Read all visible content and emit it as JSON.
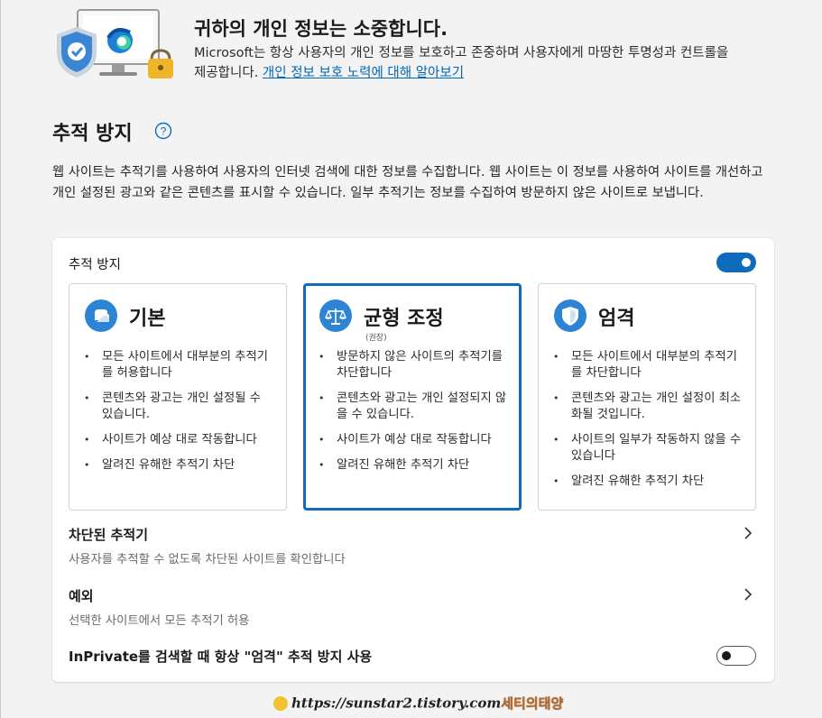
{
  "hero": {
    "title": "귀하의 개인 정보는 소중합니다.",
    "description": "Microsoft는 항상 사용자의 개인 정보를 보호하고 존중하며 사용자에게 마땅한 투명성과 컨트롤을 제공합니다. ",
    "link": "개인 정보 보호 노력에 대해 알아보기"
  },
  "section": {
    "title": "추적 방지",
    "description": "웹 사이트는 추적기를 사용하여 사용자의 인터넷 검색에 대한 정보를 수집합니다. 웹 사이트는 이 정보를 사용하여 사이트를 개선하고 개인 설정된 광고와 같은 콘텐츠를 표시할 수 있습니다. 일부 추적기는 정보를 수집하여 방문하지 않은 사이트로 보냅니다."
  },
  "card": {
    "toggle_label": "추적 방지",
    "toggle_on": true,
    "options": [
      {
        "title": "기본",
        "subtitle": "",
        "icon": "basic-shield-icon",
        "selected": false,
        "bullets": [
          "모든 사이트에서 대부분의 추적기를 허용합니다",
          "콘텐츠와 광고는 개인 설정될 수 있습니다.",
          "사이트가 예상 대로 작동합니다",
          "알려진 유해한 추적기 차단"
        ]
      },
      {
        "title": "균형 조정",
        "subtitle": "(권장)",
        "icon": "balance-scale-icon",
        "selected": true,
        "bullets": [
          "방문하지 않은 사이트의 추적기를 차단합니다",
          "콘텐츠와 광고는 개인 설정되지 않을 수 있습니다.",
          "사이트가 예상 대로 작동합니다",
          "알려진 유해한 추적기 차단"
        ]
      },
      {
        "title": "엄격",
        "subtitle": "",
        "icon": "strict-shield-icon",
        "selected": false,
        "bullets": [
          "모든 사이트에서 대부분의 추적기를 차단합니다",
          "콘텐츠와 광고는 개인 설정이 최소화될 것입니다.",
          "사이트의 일부가 작동하지 않을 수 있습니다",
          "알려진 유해한 추적기 차단"
        ]
      }
    ],
    "blocked": {
      "title": "차단된 추적기",
      "subtitle": "사용자를 추적할 수 없도록 차단된 사이트를 확인합니다"
    },
    "exceptions": {
      "title": "예외",
      "subtitle": "선택한 사이트에서 모든 추적기 허용"
    },
    "inprivate": {
      "label": "InPrivate를 검색할 때 항상 \"엄격\" 추적 방지 사용",
      "toggle_on": false
    }
  },
  "watermark": {
    "url": "https://sunstar2.tistory.com",
    "name": "세티의태양"
  },
  "colors": {
    "accent": "#0f6cbd",
    "link": "#0067b8",
    "icon_blue": "#2d84d4",
    "background": "#f3f3f3"
  }
}
